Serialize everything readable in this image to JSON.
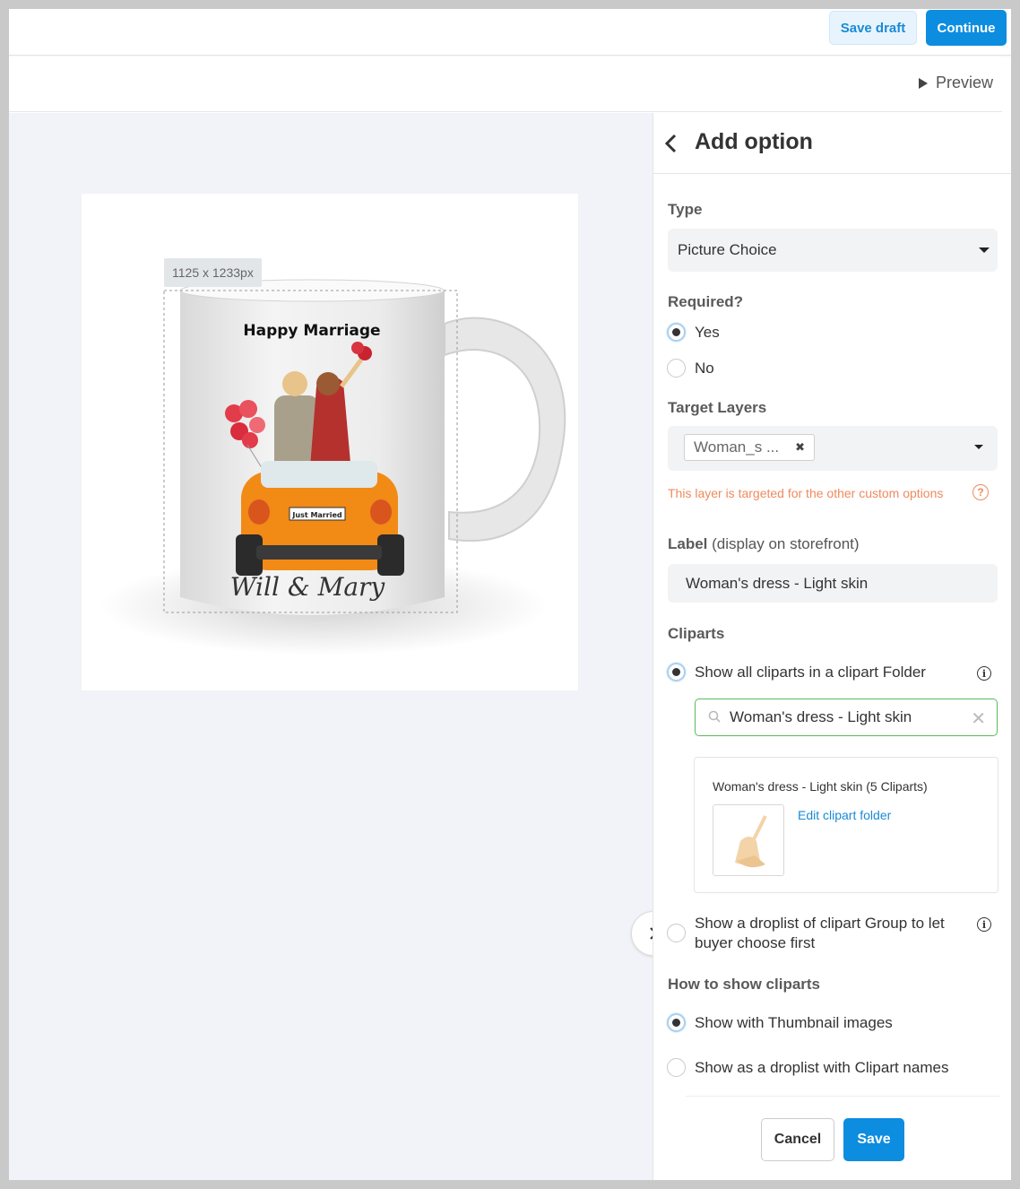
{
  "topbar": {
    "save_draft": "Save draft",
    "continue": "Continue"
  },
  "preview": {
    "label": "Preview"
  },
  "canvas": {
    "size_label": "1125 x 1233px",
    "mug_title": "Happy Marriage",
    "mug_names": "Will & Mary",
    "plate_text": "Just Married"
  },
  "panel": {
    "title": "Add option",
    "type": {
      "label": "Type",
      "value": "Picture Choice"
    },
    "required": {
      "label": "Required?",
      "options": [
        "Yes",
        "No"
      ],
      "selected": "Yes"
    },
    "target_layers": {
      "label": "Target Layers",
      "chip": "Woman_s ...",
      "warning": "This layer is targeted for the other custom options"
    },
    "label_field": {
      "label": "Label",
      "sub": "(display on storefront)",
      "value": "Woman's dress - Light skin"
    },
    "cliparts": {
      "label": "Cliparts",
      "option_folder": "Show all cliparts in a clipart Folder",
      "search_value": "Woman's dress - Light skin",
      "folder_name": "Woman's dress - Light skin",
      "folder_count": "(5 Cliparts)",
      "edit_link": "Edit clipart folder",
      "option_group": "Show a droplist of clipart Group to let buyer choose first"
    },
    "how_to_show": {
      "label": "How to show cliparts",
      "options": [
        "Show with Thumbnail images",
        "Show as a droplist with Clipart names"
      ],
      "selected": "Show with Thumbnail images"
    },
    "footer": {
      "cancel": "Cancel",
      "save": "Save"
    }
  },
  "colors": {
    "accent": "#0d8de0",
    "warning": "#f08a5d",
    "success_border": "#5cb85c"
  }
}
